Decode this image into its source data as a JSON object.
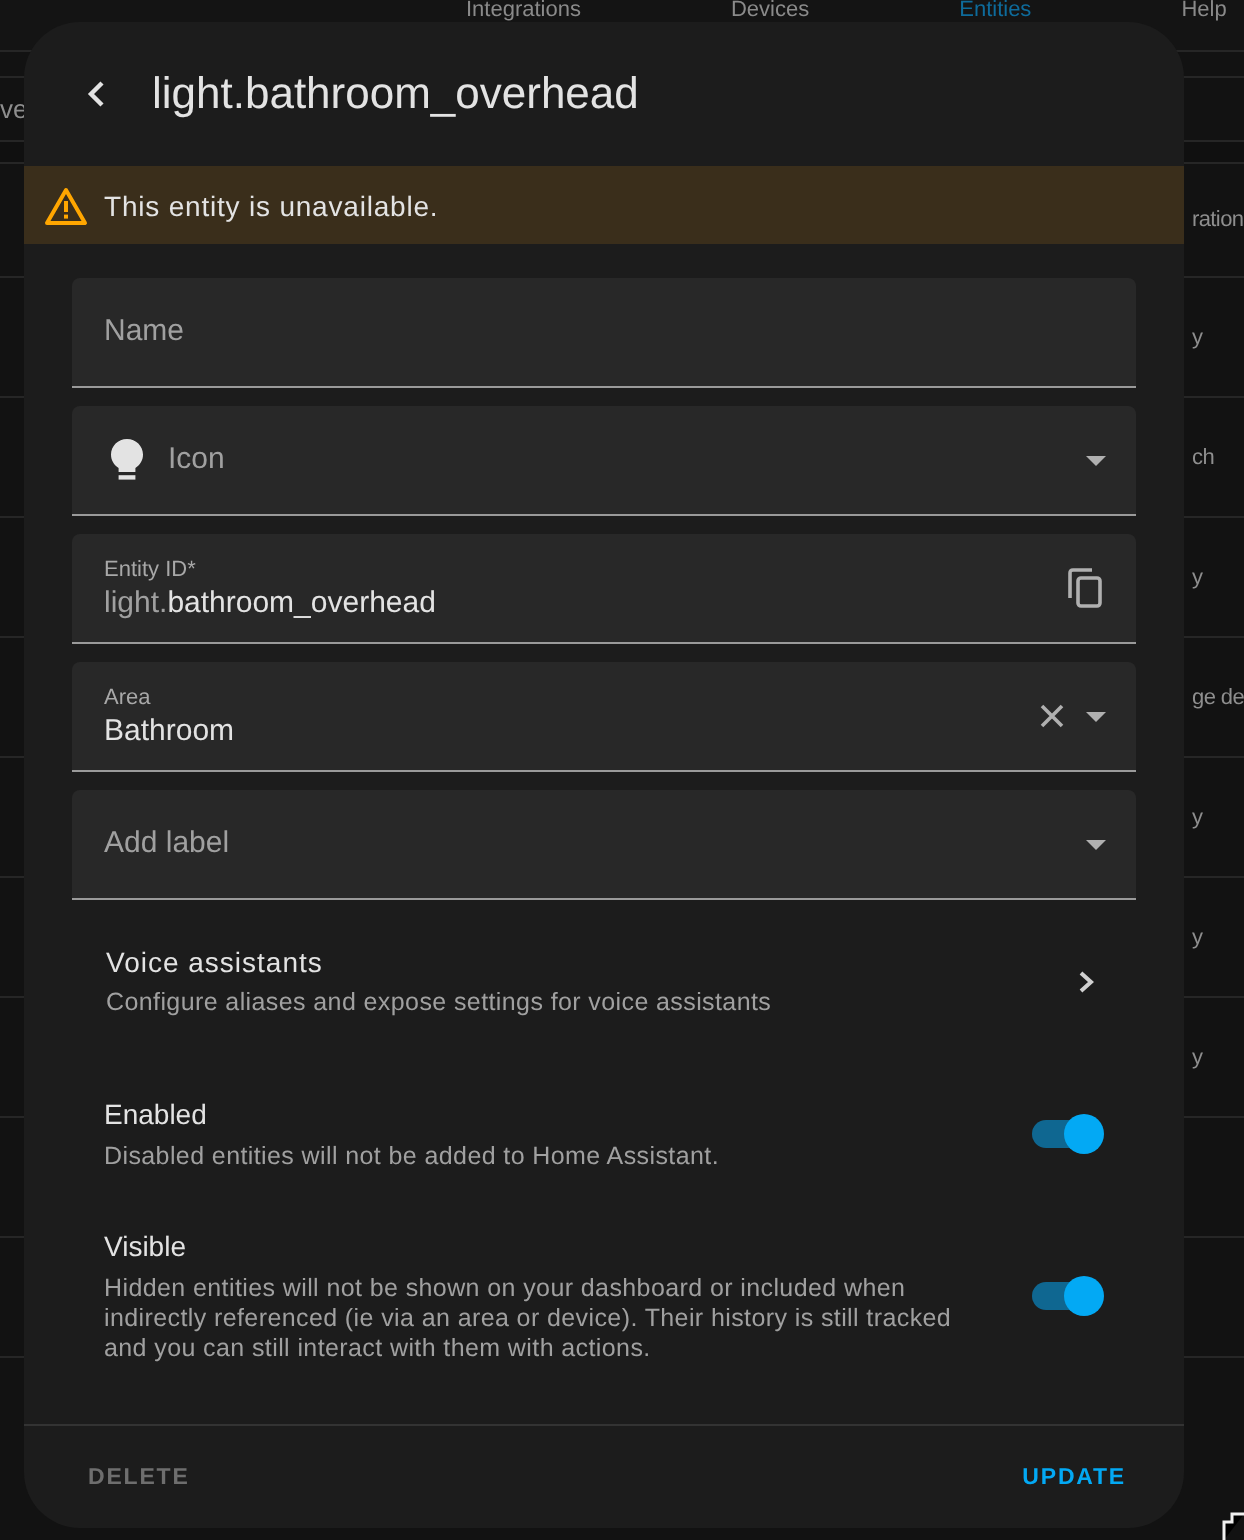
{
  "background": {
    "tabs": [
      {
        "label": "Integrations",
        "selected": false
      },
      {
        "label": "Devices",
        "selected": false
      },
      {
        "label": "Entities",
        "selected": true
      },
      {
        "label": "Help",
        "selected": false
      }
    ],
    "left_text": "ve",
    "column_header": "ration",
    "cells": [
      "y",
      "ch",
      "y",
      "ge de",
      "y",
      "y",
      "y"
    ]
  },
  "dialog": {
    "title": "light.bathroom_overhead",
    "warning": "This entity is unavailable.",
    "fields": [
      {
        "kind": "name",
        "placeholder": "Name"
      },
      {
        "kind": "icon",
        "placeholder": "Icon"
      },
      {
        "kind": "entity_id",
        "label": "Entity ID*",
        "prefix": "light.",
        "value": "bathroom_overhead"
      },
      {
        "kind": "area",
        "label": "Area",
        "value": "Bathroom"
      },
      {
        "kind": "labels",
        "placeholder": "Add label"
      }
    ],
    "voice_assistants": {
      "title": "Voice assistants",
      "subtitle": "Configure aliases and expose settings for voice assistants"
    },
    "toggles": [
      {
        "title": "Enabled",
        "description": "Disabled entities will not be added to Home Assistant.",
        "on": true
      },
      {
        "title": "Visible",
        "description": "Hidden entities will not be shown on your dashboard or included when indirectly referenced (ie via an area or device). Their history is still tracked and you can still interact with them with actions.",
        "on": true
      }
    ],
    "buttons": [
      {
        "kind": "delete",
        "label": "DELETE",
        "disabled": true
      },
      {
        "kind": "update",
        "label": "UPDATE",
        "disabled": false
      }
    ]
  }
}
